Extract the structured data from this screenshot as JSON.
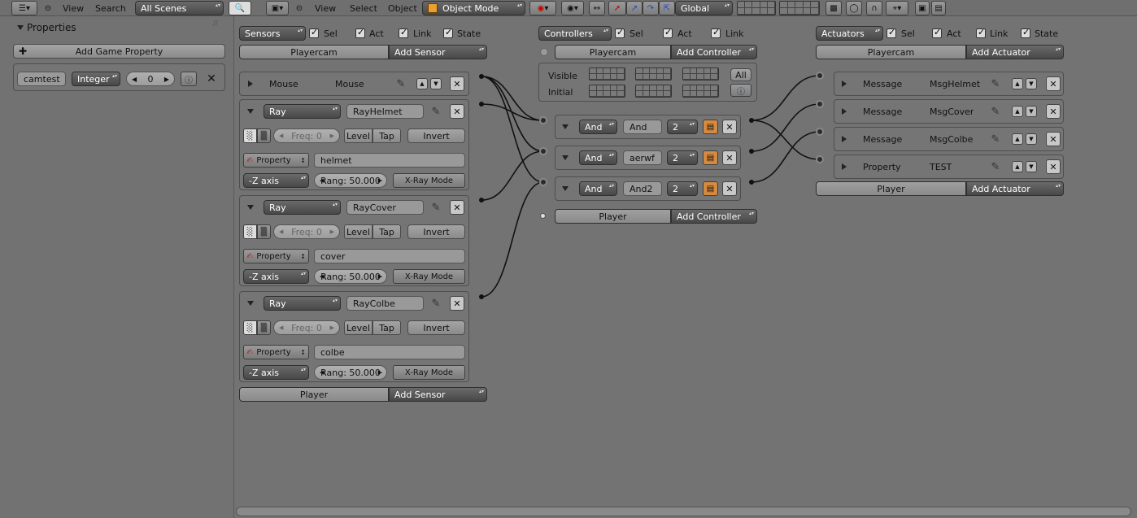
{
  "topbar": {
    "view1": "View",
    "search": "Search",
    "scene": "All Scenes",
    "view2": "View",
    "select": "Select",
    "object": "Object",
    "mode": "Object Mode",
    "orientation": "Global"
  },
  "properties": {
    "header": "Properties",
    "add_button": "Add Game Property",
    "prop_name": "camtest",
    "prop_type": "Integer",
    "prop_value": "0"
  },
  "sensors": {
    "header": "Sensors",
    "filters": [
      "Sel",
      "Act",
      "Link",
      "State"
    ],
    "object1": "Playercam",
    "add1": "Add Sensor",
    "object2": "Player",
    "add2": "Add Sensor",
    "mouse": {
      "type": "Mouse",
      "name": "Mouse"
    },
    "rays": [
      {
        "type": "Ray",
        "name": "RayHelmet",
        "freq": "Freq: 0",
        "level": "Level",
        "tap": "Tap",
        "invert": "Invert",
        "prop_label": "Property",
        "prop_value": "helmet",
        "axis": "-Z axis",
        "range": "Rang: 50.000",
        "xray": "X-Ray Mode"
      },
      {
        "type": "Ray",
        "name": "RayCover",
        "freq": "Freq: 0",
        "level": "Level",
        "tap": "Tap",
        "invert": "Invert",
        "prop_label": "Property",
        "prop_value": "cover",
        "axis": "-Z axis",
        "range": "Rang: 50.000",
        "xray": "X-Ray Mode"
      },
      {
        "type": "Ray",
        "name": "RayColbe",
        "freq": "Freq: 0",
        "level": "Level",
        "tap": "Tap",
        "invert": "Invert",
        "prop_label": "Property",
        "prop_value": "colbe",
        "axis": "-Z axis",
        "range": "Rang: 50.000",
        "xray": "X-Ray Mode"
      }
    ]
  },
  "controllers": {
    "header": "Controllers",
    "filters": [
      "Sel",
      "Act",
      "Link"
    ],
    "object1": "Playercam",
    "add1": "Add Controller",
    "visible": "Visible",
    "initial": "Initial",
    "all": "All",
    "object2": "Player",
    "add2": "Add Controller",
    "items": [
      {
        "type": "And",
        "name": "And",
        "state": "2"
      },
      {
        "type": "And",
        "name": "aerwf",
        "state": "2"
      },
      {
        "type": "And",
        "name": "And2",
        "state": "2"
      }
    ]
  },
  "actuators": {
    "header": "Actuators",
    "filters": [
      "Sel",
      "Act",
      "Link",
      "State"
    ],
    "object1": "Playercam",
    "add1": "Add Actuator",
    "object2": "Player",
    "add2": "Add Actuator",
    "items": [
      {
        "type": "Message",
        "name": "MsgHelmet"
      },
      {
        "type": "Message",
        "name": "MsgCover"
      },
      {
        "type": "Message",
        "name": "MsgColbe"
      },
      {
        "type": "Property",
        "name": "TEST"
      }
    ]
  }
}
